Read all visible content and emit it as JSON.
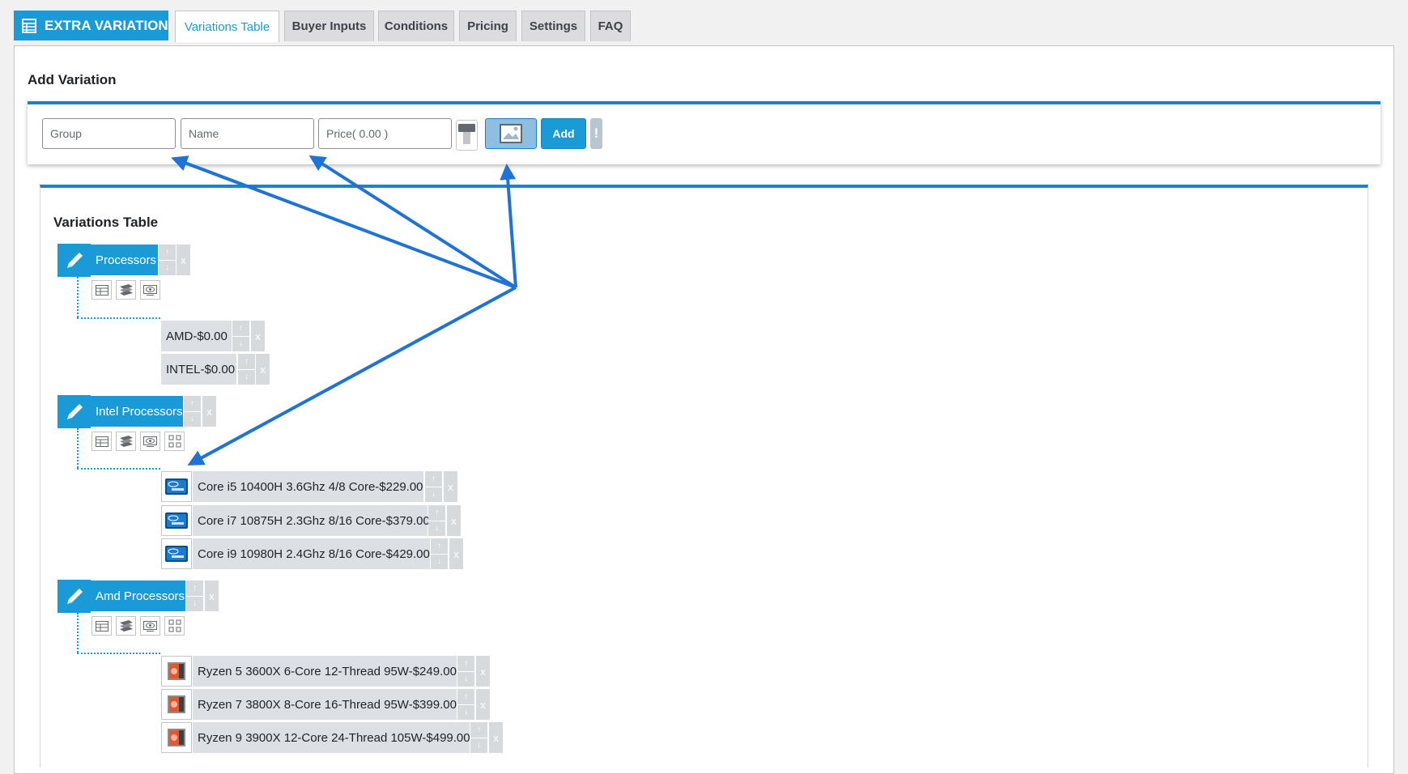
{
  "header": {
    "brand": "EXTRA VARIATION",
    "tabs": [
      {
        "label": "Variations Table"
      },
      {
        "label": "Buyer Inputs"
      },
      {
        "label": "Conditions"
      },
      {
        "label": "Pricing"
      },
      {
        "label": "Settings"
      },
      {
        "label": "FAQ"
      }
    ],
    "active_tab": "Variations Table"
  },
  "add_variation": {
    "title": "Add Variation",
    "group_placeholder": "Group",
    "name_placeholder": "Name",
    "price_placeholder": "Price( 0.00 )",
    "add_label": "Add",
    "info_label": "!"
  },
  "variations_table": {
    "title": "Variations Table",
    "arrow_glyph_up": "↑",
    "arrow_glyph_down": "↓",
    "remove_glyph": "x",
    "groups": [
      {
        "name": "Processors",
        "items": [
          {
            "label": "AMD-$0.00"
          },
          {
            "label": "INTEL-$0.00"
          }
        ]
      },
      {
        "name": "Intel Processors",
        "items": [
          {
            "label": "Core i5 10400H 3.6Ghz 4/8 Core-$229.00",
            "icon": "intel-chip-icon"
          },
          {
            "label": "Core i7 10875H 2.3Ghz 8/16 Core-$379.00",
            "icon": "intel-chip-icon"
          },
          {
            "label": "Core i9 10980H 2.4Ghz 8/16 Core-$429.00",
            "icon": "intel-chip-icon"
          }
        ]
      },
      {
        "name": "Amd Processors",
        "items": [
          {
            "label": "Ryzen 5 3600X 6-Core 12-Thread 95W-$249.00",
            "icon": "amd-ryzen-box-icon"
          },
          {
            "label": "Ryzen 7 3800X 8-Core 16-Thread 95W-$399.00",
            "icon": "amd-ryzen-box-icon"
          },
          {
            "label": "Ryzen 9 3900X 12-Core 24-Thread 105W-$499.00",
            "icon": "amd-ryzen-box-icon"
          }
        ]
      }
    ]
  },
  "colors": {
    "accent": "#1a9bd7",
    "arrow": "#1f73d6",
    "item_bg": "#dcdfe3"
  }
}
